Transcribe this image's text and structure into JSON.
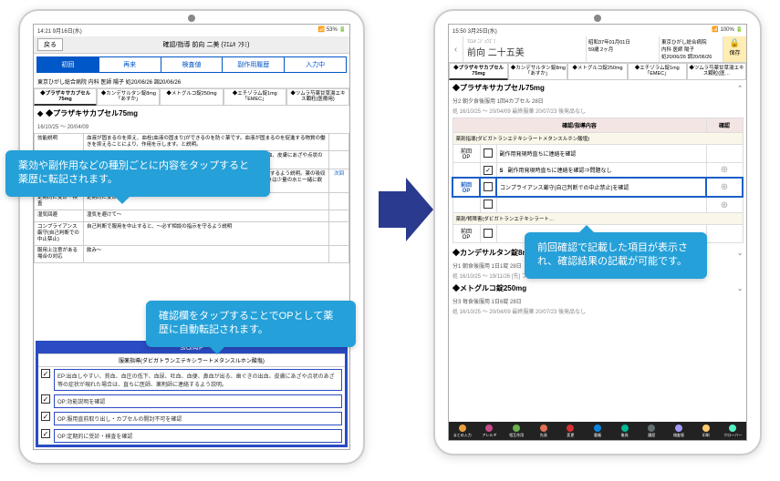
{
  "left": {
    "status": {
      "time": "14:21 9月16日(水)",
      "batt": "53%"
    },
    "back": "戻る",
    "header": "確認/指導 前向 二美 (ﾏｴﾑｷ ﾌﾀﾐ)",
    "tabs": [
      "初回",
      "再来",
      "検査値",
      "副作用履歴",
      "入力中"
    ],
    "hospital_row": "東京ひがし総合病院 内科 医師 陽子 処20/06/26 調20/06/26",
    "drug_tabs": [
      "◆プラザキサカプセル75mg",
      "◆カンデサルタン錠8mg「あすか」",
      "◆メトグルコ錠250mg",
      "◆エチゾラム錠1mg「EMEC」",
      "◆ツムラ芍薬甘草湯エキス顆粒(医療用)"
    ],
    "drug_title": "◆プラザキサカプセル75mg",
    "drug_date": "16/10/25 〜 20/04/09",
    "rows": [
      {
        "label": "効能説明",
        "text": "血液が固まるのを抑え、血栓(血液の固まり)ができるのを防ぐ薬です。血液が固まるのを促進する物質の働きを抑えることにより、作用を示します。と説明。"
      },
      {
        "label": "副作用発現時直ちに連絡",
        "text": "出血しやすい、貧血、血圧の低下、血尿、吐血、血便、鼻血が出る、歯ぐきの出血、皮膚にあざや点状のあざ等の症状が現れた場合は、直ちに医師、薬剤師に連絡するよう説明。"
      },
      {
        "label": "服用直前取り出し・カプセルの開封不可",
        "text": "この薬は吸湿性が強いので、服用する直前に包装(PTPシート)から取り出して服用するよう説明。薬の吸収に影響するので、カプセルを開けて服用しないよう説明。苦いので飲みにくいときは少量の水と一緒に飲む。",
        "next": "次回"
      },
      {
        "label": "定期的に受診・検査",
        "text": "定期的に受診し〜"
      },
      {
        "label": "湿気回避",
        "text": "湿気を避けて〜"
      },
      {
        "label": "コンプライアンス厳守(自己判断での中止禁止)",
        "text": "自己判断で服用を中止すると、〜必ず相談の指示を守るよう説明"
      },
      {
        "label": "服用上注意がある場合の対応",
        "text": "飲み〜"
      }
    ],
    "soap": {
      "title": "S/O/A/P",
      "subtitle": "服薬指導(ダビガトランエテキシラートメタンスルホン酸塩)",
      "items": [
        {
          "chk": true,
          "text": "EP:出血しやすい、貧血、血圧の低下、血尿、吐血、血便、鼻血が出る、歯ぐきの出血、皮膚にあざや点状のあざ等の症状が現れた場合は、直ちに医師、薬剤師に連絡するよう説明。"
        },
        {
          "chk": true,
          "text": "OP:効能説明を確認"
        },
        {
          "chk": true,
          "text": "OP:服用直前取り出し・カプセルの開封不可を確認"
        },
        {
          "chk": true,
          "text": "OP:定期的に受診・検査を確認"
        }
      ]
    }
  },
  "right": {
    "status": {
      "time": "15:50 3月25日(水)",
      "batt": "100%"
    },
    "patient": {
      "kana": "ﾏｴﾑｷ ﾆｼﾞｭｳｺﾞﾐ",
      "name": "前向 二十五美",
      "dob": "昭和37年01月01日",
      "age": "59歳 2ヶ月"
    },
    "hospital": {
      "name": "東京ひがし総合病院",
      "dept": "内科 医師 陽子",
      "rx": "処20/06/26",
      "disp": "調20/06/26"
    },
    "save": "保存",
    "drug_tabs": [
      "◆プラザキサカプセル75mg",
      "◆カンデサルタン錠8mg「あすか」",
      "◆メトグルコ錠250mg",
      "◆エチゾラム錠1mg「EMEC」",
      "◆ツムラ芍薬甘草湯エキス顆粒(医…"
    ],
    "drug1": {
      "title": "◆プラザキサカプセル75mg",
      "dose": "分2 朝夕食後服用 1回4カプセル 28日",
      "dates": "処 16/10/25 〜 20/04/09  最終服薬 20/07/23  後発品なし",
      "guide_label": "薬剤指導(ダビガトランエテキシラートメタンスルホン酸塩)",
      "header": "確認/指導内容",
      "confirm": "確認",
      "rows": [
        {
          "code": "前回\nOP",
          "chk": false,
          "text": "副作用発現時直ちに連絡を確認",
          "add": false
        },
        {
          "code": "",
          "chk": true,
          "sub": "S",
          "text": "副作用発現時直ちに連絡を確認⇒問題なし",
          "add": true
        },
        {
          "code": "前回\nOP",
          "chk": false,
          "text": "コンプライアンス厳守(自己判断での中止禁止)を確認",
          "add": true,
          "hl": true
        },
        {
          "code": "",
          "chk": false,
          "text": "",
          "add": true
        }
      ],
      "guide2_label": "薬剤/腎障害(ダビガトランエテキシラート…",
      "guide2_row": {
        "code": "前回\nOP",
        "text": ""
      }
    },
    "drug2": {
      "title": "◆カンデサルタン錠8mg「あすか」",
      "dose": "分1 朝食後服用 1日1錠 28日",
      "dates": "処 16/10/25 〜 19/11/26  [先] プロプレス錠8"
    },
    "drug3": {
      "title": "◆メトグルコ錠250mg",
      "dose": "分3 毎食後服用 1日6錠 28日",
      "dates": "処 16/10/25 〜 20/04/09  最終服薬 20/07/23  後発品なし"
    },
    "bottom_icons": [
      "まとめ入力",
      "アレルギ",
      "相互作用",
      "先発",
      "変更",
      "重複",
      "後発",
      "履歴",
      "検査値",
      "印刷",
      "クローバー"
    ]
  },
  "callouts": {
    "c1": "薬効や副作用などの種別ごとに内容をタップすると薬歴に転記されます。",
    "c2": "確認欄をタップすることでOPとして薬歴に自動転記されます。",
    "c3": "前回確認で記載した項目が表示され、確認結果の記載が可能です。"
  }
}
